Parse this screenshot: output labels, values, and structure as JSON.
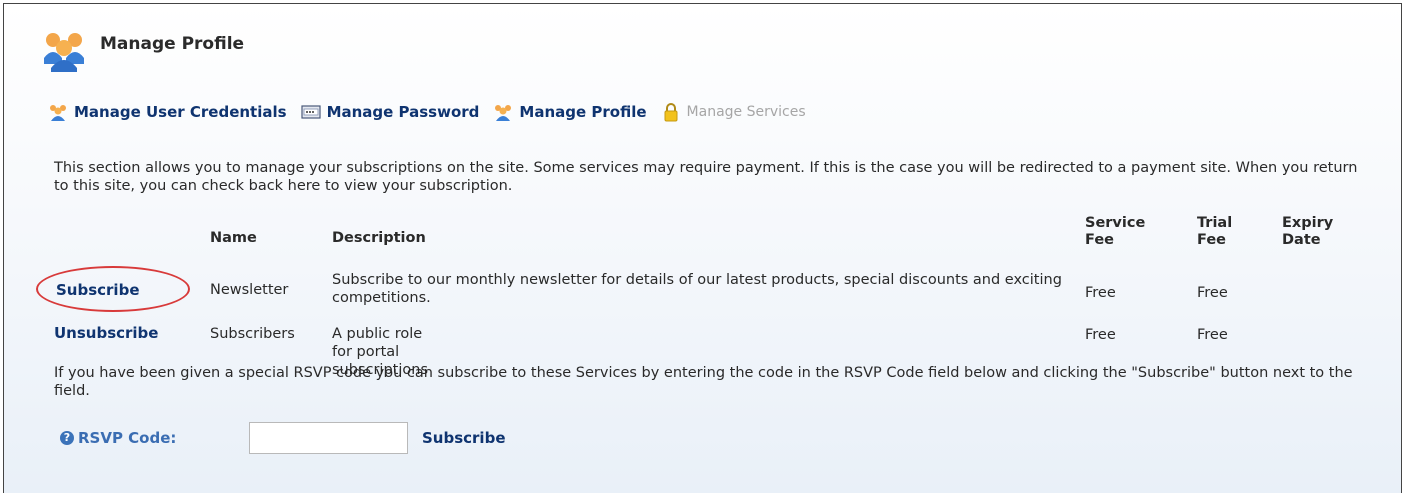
{
  "header": {
    "title": "Manage Profile",
    "icon": "users-icon"
  },
  "tabs": [
    {
      "label": "Manage User Credentials",
      "icon": "users-icon",
      "enabled": true
    },
    {
      "label": "Manage Password",
      "icon": "password-field-icon",
      "enabled": true
    },
    {
      "label": "Manage Profile",
      "icon": "users-icon",
      "enabled": true
    },
    {
      "label": "Manage Services",
      "icon": "lock-icon",
      "enabled": false
    }
  ],
  "intro": "This section allows you to manage your subscriptions on the site. Some services may require payment. If this is the case you will be redirected to a payment site. When you return to this site, you can check back here to view your subscription.",
  "table": {
    "headers": {
      "name": "Name",
      "description": "Description",
      "service_fee": "Service Fee",
      "trial_fee": "Trial Fee",
      "expiry_date": "Expiry Date"
    },
    "rows": [
      {
        "action": "Subscribe",
        "name": "Newsletter",
        "description": "Subscribe to our monthly newsletter for details of our latest products, special discounts and exciting competitions.",
        "service_fee": "Free",
        "trial_fee": "Free",
        "expiry_date": ""
      },
      {
        "action": "Unsubscribe",
        "name": "Subscribers",
        "description": "A public role for portal subscriptions",
        "service_fee": "Free",
        "trial_fee": "Free",
        "expiry_date": ""
      }
    ]
  },
  "rsvp": {
    "text": "If you have been given a special RSVP code you can subscribe to these Services by entering the code in the RSVP Code field below and clicking the \"Subscribe\" button next to the field.",
    "label": "RSVP Code:",
    "value": "",
    "button": "Subscribe"
  },
  "colors": {
    "link": "#0f3470",
    "label_blue": "#3a6db2",
    "highlight_ring": "#d83a3a",
    "disabled": "#a6a6a6"
  }
}
